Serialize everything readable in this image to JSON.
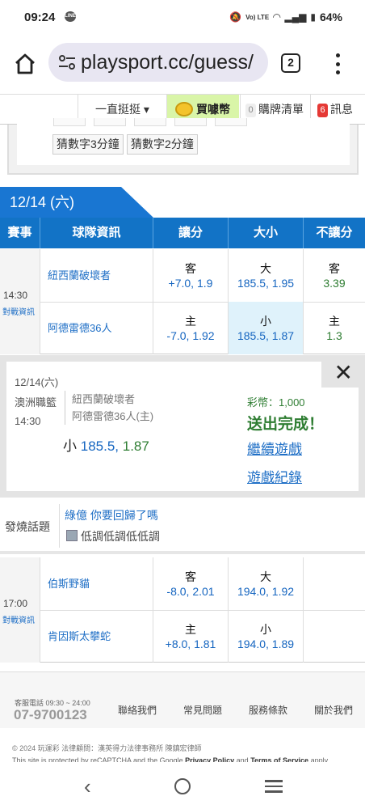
{
  "status": {
    "time": "09:24",
    "battery": "64%",
    "line": "LINE",
    "volte": "Vo) LTE"
  },
  "browser": {
    "url": "playsport.cc/guess/",
    "tabs_count": "2"
  },
  "nav": {
    "guide": "一直挺挺 ▾",
    "buy": "買噱幣",
    "cart_count": "0",
    "cart": "購牌清單",
    "msg_count": "6",
    "msg": "訊息"
  },
  "games": {
    "chip1": "猜數字3分鐘",
    "chip2": "猜數字2分鐘"
  },
  "date_tag": "12/14 (六)",
  "table_head": {
    "event": "賽事",
    "team": "球隊資訊",
    "spread": "讓分",
    "total": "大小",
    "moneyline": "不讓分"
  },
  "matches": [
    {
      "time": "14:30",
      "info": "對戰資訊",
      "away": {
        "name": "紐西蘭破壞者",
        "spread_label": "客",
        "spread_val": "+7.0, 1.9",
        "total_label": "大",
        "total_val": "185.5, 1.95",
        "ml_label": "客",
        "ml_val": "3.39"
      },
      "home": {
        "name": "阿德雷德36人",
        "spread_label": "主",
        "spread_val": "-7.0, 1.92",
        "total_label": "小",
        "total_val": "185.5, 1.87",
        "ml_label": "主",
        "ml_val": "1.3"
      }
    },
    {
      "time": "17:00",
      "info": "對戰資訊",
      "away": {
        "name": "伯斯野貓",
        "spread_label": "客",
        "spread_val": "-8.0, 2.01",
        "total_label": "大",
        "total_val": "194.0, 1.92"
      },
      "home": {
        "name": "肯因斯太攀蛇",
        "spread_label": "主",
        "spread_val": "+8.0, 1.81",
        "total_label": "小",
        "total_val": "194.0, 1.89"
      }
    }
  ],
  "popup": {
    "date": "12/14(六)",
    "league": "澳洲職籃",
    "time": "14:30",
    "team1": "紐西蘭破壞者",
    "team2": "阿德雷德36人(主)",
    "pick_label": "小",
    "pick_num": "185.5,",
    "pick_odds": "1.87",
    "coins": "彩幣：1,000",
    "done": "送出完成！",
    "continue": "繼續遊戲",
    "record": "遊戲紀錄"
  },
  "hot": {
    "label": "發燒話題",
    "topic": "綠億 你要回歸了嗎",
    "sub": "低調低調低低調"
  },
  "footer": {
    "service_label": "客服電話 09:30 ~ 24:00",
    "service_num": "07-9700123",
    "links": [
      "聯絡我們",
      "常見問題",
      "服務條款",
      "關於我們"
    ],
    "copyright": "© 2024 玩運彩 法律顧問：漢英得力法律事務所 陳鎮宏律師",
    "captcha_pre": "This site is protected by reCAPTCHA and the Google ",
    "privacy": "Privacy Policy",
    "and": " and ",
    "terms": "Terms of Service",
    "apply": " apply."
  }
}
